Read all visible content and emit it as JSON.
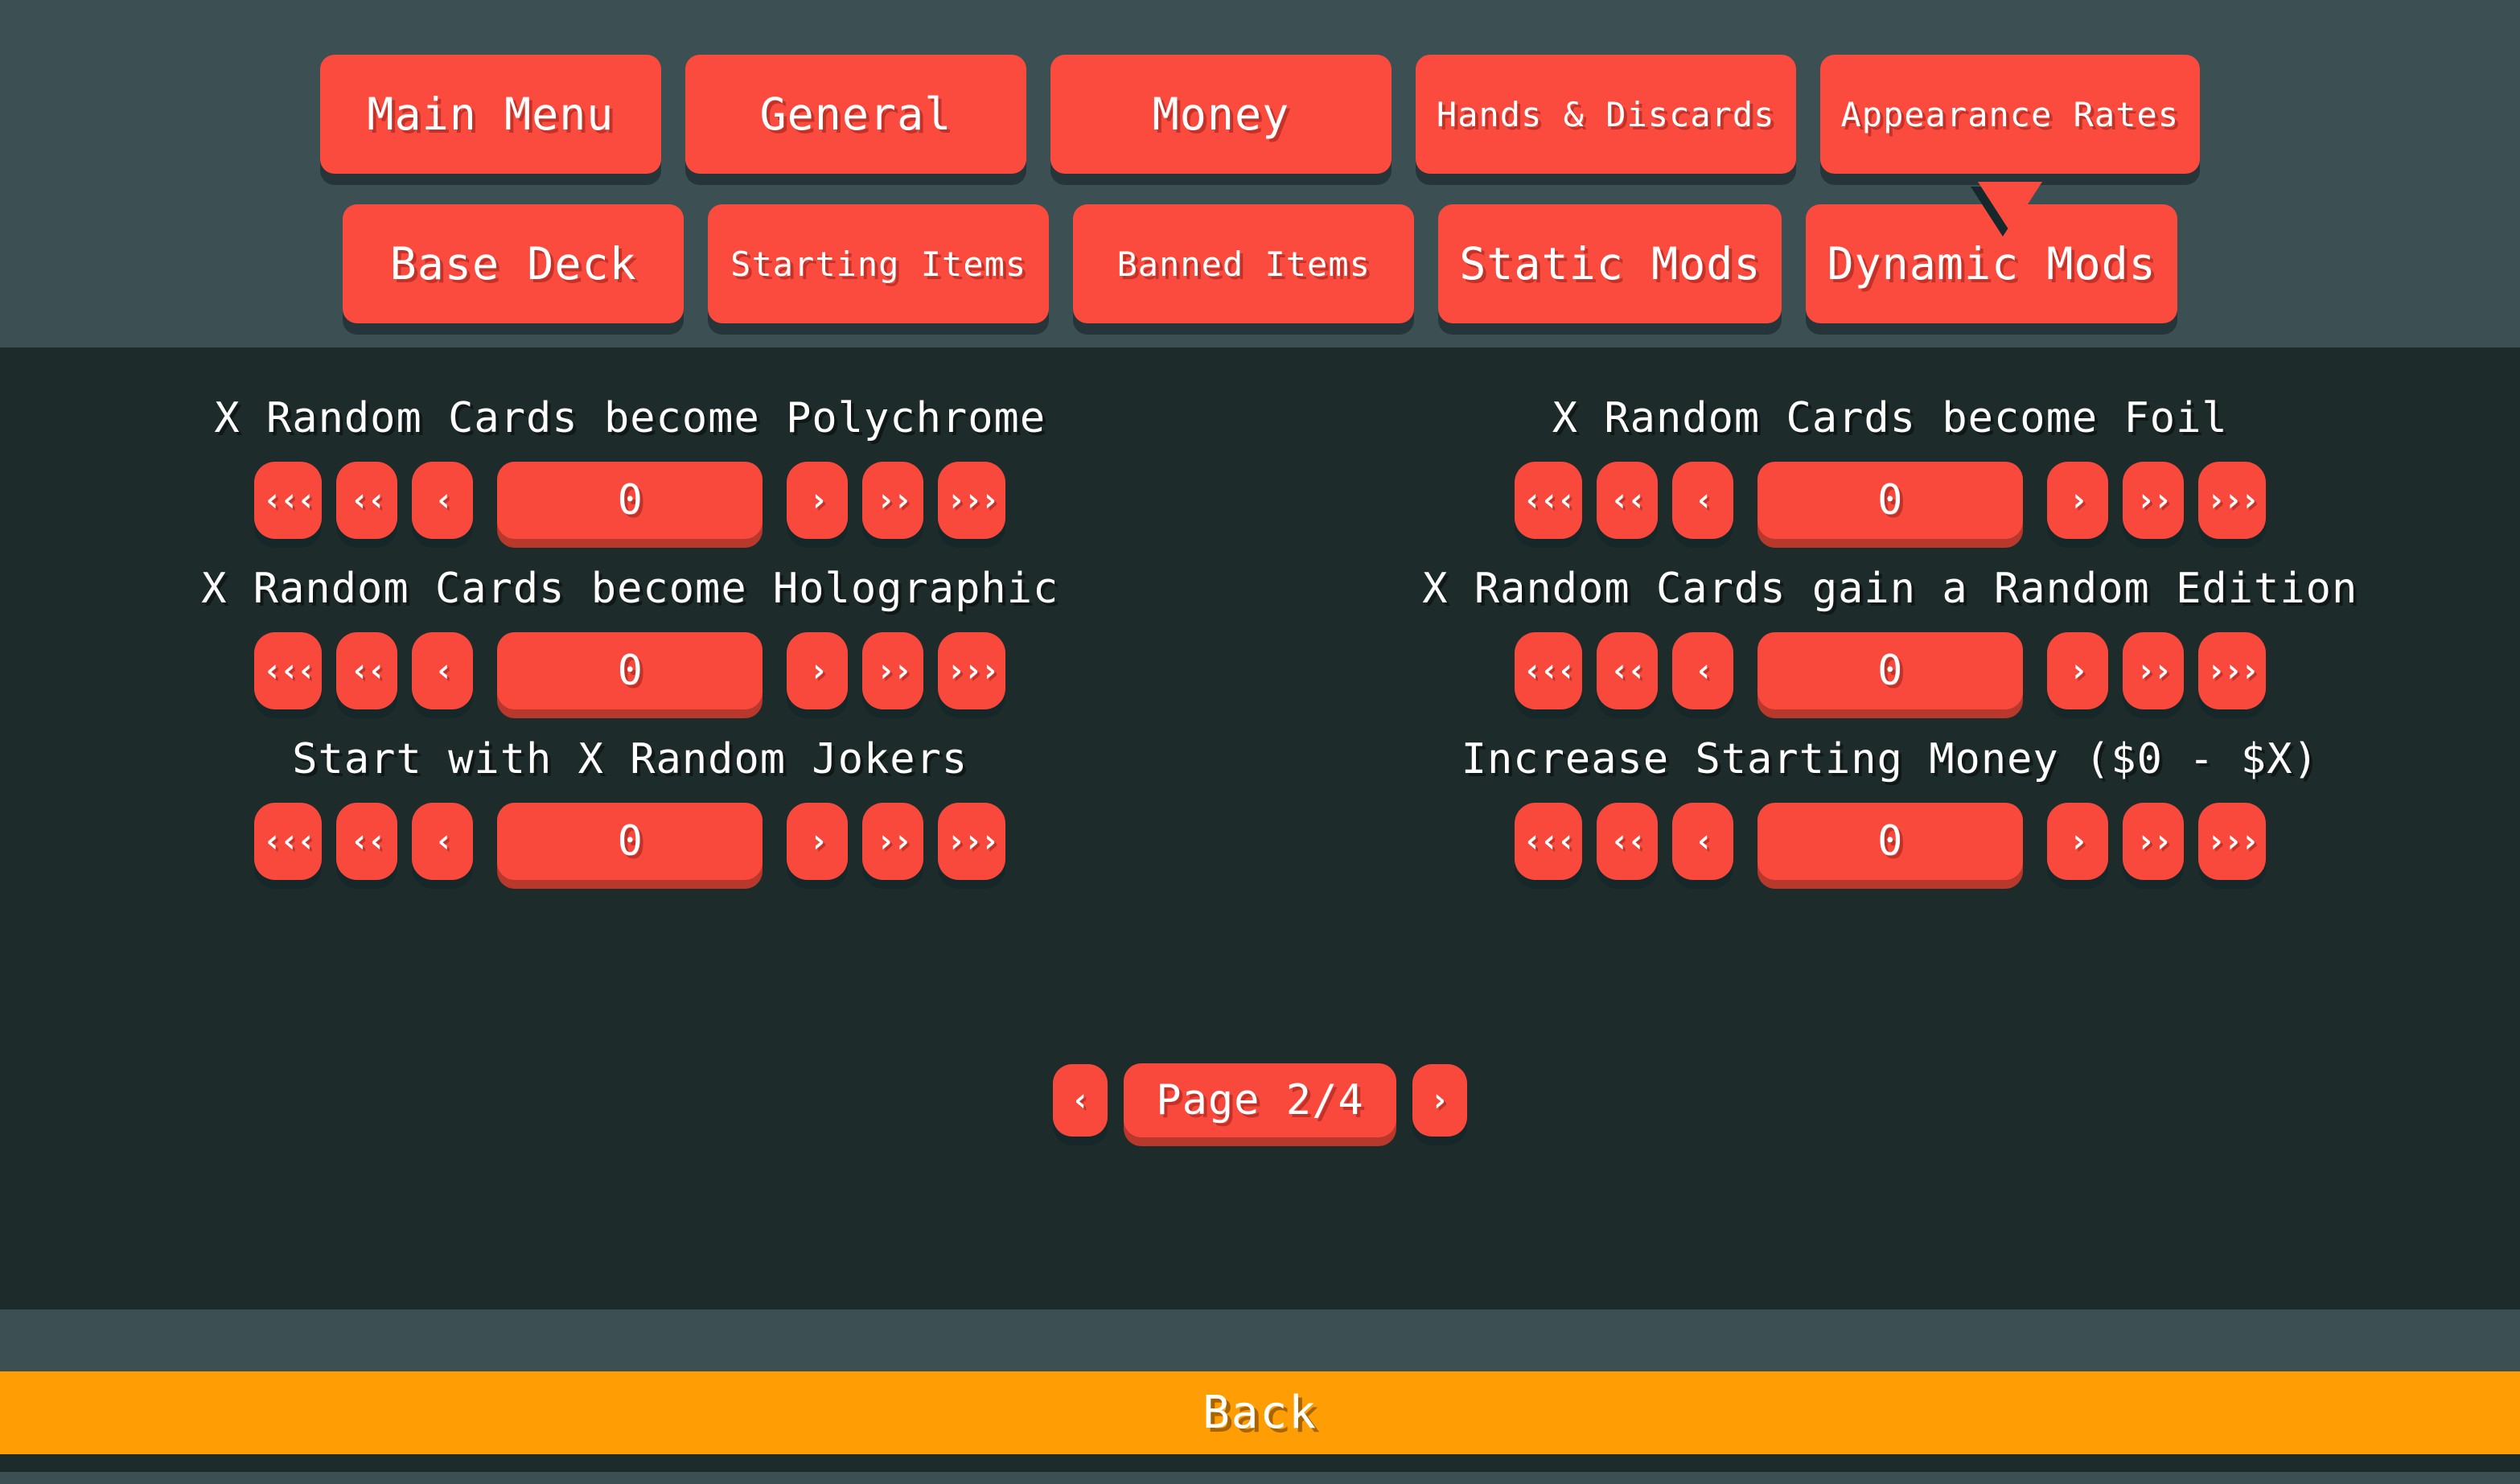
{
  "theme": {
    "header_bg": "#3c5054",
    "panel_bg": "#1e2b2b",
    "button_red": "#fb4a3e",
    "button_shadow": "#25353a",
    "value_shadow": "#b8382c",
    "back_orange": "#ff9d05",
    "text_white": "#ffffff"
  },
  "nav": {
    "row1": [
      {
        "label": "Main Menu",
        "size": "lg",
        "active": false
      },
      {
        "label": "General",
        "size": "lg",
        "active": false
      },
      {
        "label": "Money",
        "size": "lg",
        "active": false
      },
      {
        "label": "Hands & Discards",
        "size": "sm",
        "active": false
      },
      {
        "label": "Appearance Rates",
        "size": "sm",
        "active": true
      }
    ],
    "row2": [
      {
        "label": "Base Deck",
        "size": "lg",
        "active": false
      },
      {
        "label": "Starting Items",
        "size": "sm",
        "active": false
      },
      {
        "label": "Banned Items",
        "size": "sm",
        "active": false
      },
      {
        "label": "Static Mods",
        "size": "lg",
        "active": false
      },
      {
        "label": "Dynamic Mods",
        "size": "lg",
        "active": false
      }
    ]
  },
  "stepper_icons": {
    "dec_large": "‹‹‹",
    "dec_medium": "‹‹",
    "dec_small": "‹",
    "inc_small": "›",
    "inc_medium": "››",
    "inc_large": "›››"
  },
  "settings": {
    "left": [
      {
        "label": "X Random Cards become Polychrome",
        "value": "0"
      },
      {
        "label": "X Random Cards become Holographic",
        "value": "0"
      },
      {
        "label": "Start with X Random Jokers",
        "value": "0"
      }
    ],
    "right": [
      {
        "label": "X Random Cards become Foil",
        "value": "0"
      },
      {
        "label": "X Random Cards gain a Random Edition",
        "value": "0"
      },
      {
        "label": "Increase Starting Money ($0 - $X)",
        "value": "0"
      }
    ]
  },
  "pagination": {
    "prev_icon": "‹",
    "next_icon": "›",
    "label": "Page 2/4",
    "current": 2,
    "total": 4
  },
  "footer": {
    "back_label": "Back"
  }
}
